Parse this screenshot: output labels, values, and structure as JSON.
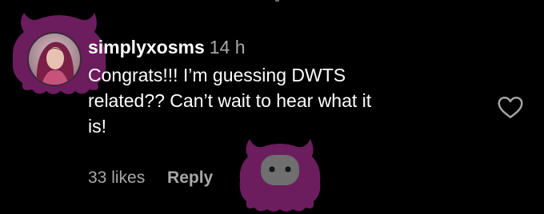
{
  "comment": {
    "username": "simplyxosms",
    "timestamp": "14 h",
    "text": "Congrats!!! I'm guessing DWTS related?? Can't wait to hear what it is!",
    "text_lines": [
      "Congrats!!! I’m guessing DWTS",
      "related?? Can’t wait to hear what it",
      "is!"
    ],
    "likes_label": "33 likes",
    "reply_label": "Reply"
  },
  "icons": {
    "like": "heart-outline-icon",
    "avatar": "profile-avatar",
    "overlay": "purple-monster-blob-icon"
  },
  "colors": {
    "background": "#000000",
    "primary_text": "#ffffff",
    "secondary_text": "#a8a8a8",
    "blob": "#6b1d5e"
  }
}
